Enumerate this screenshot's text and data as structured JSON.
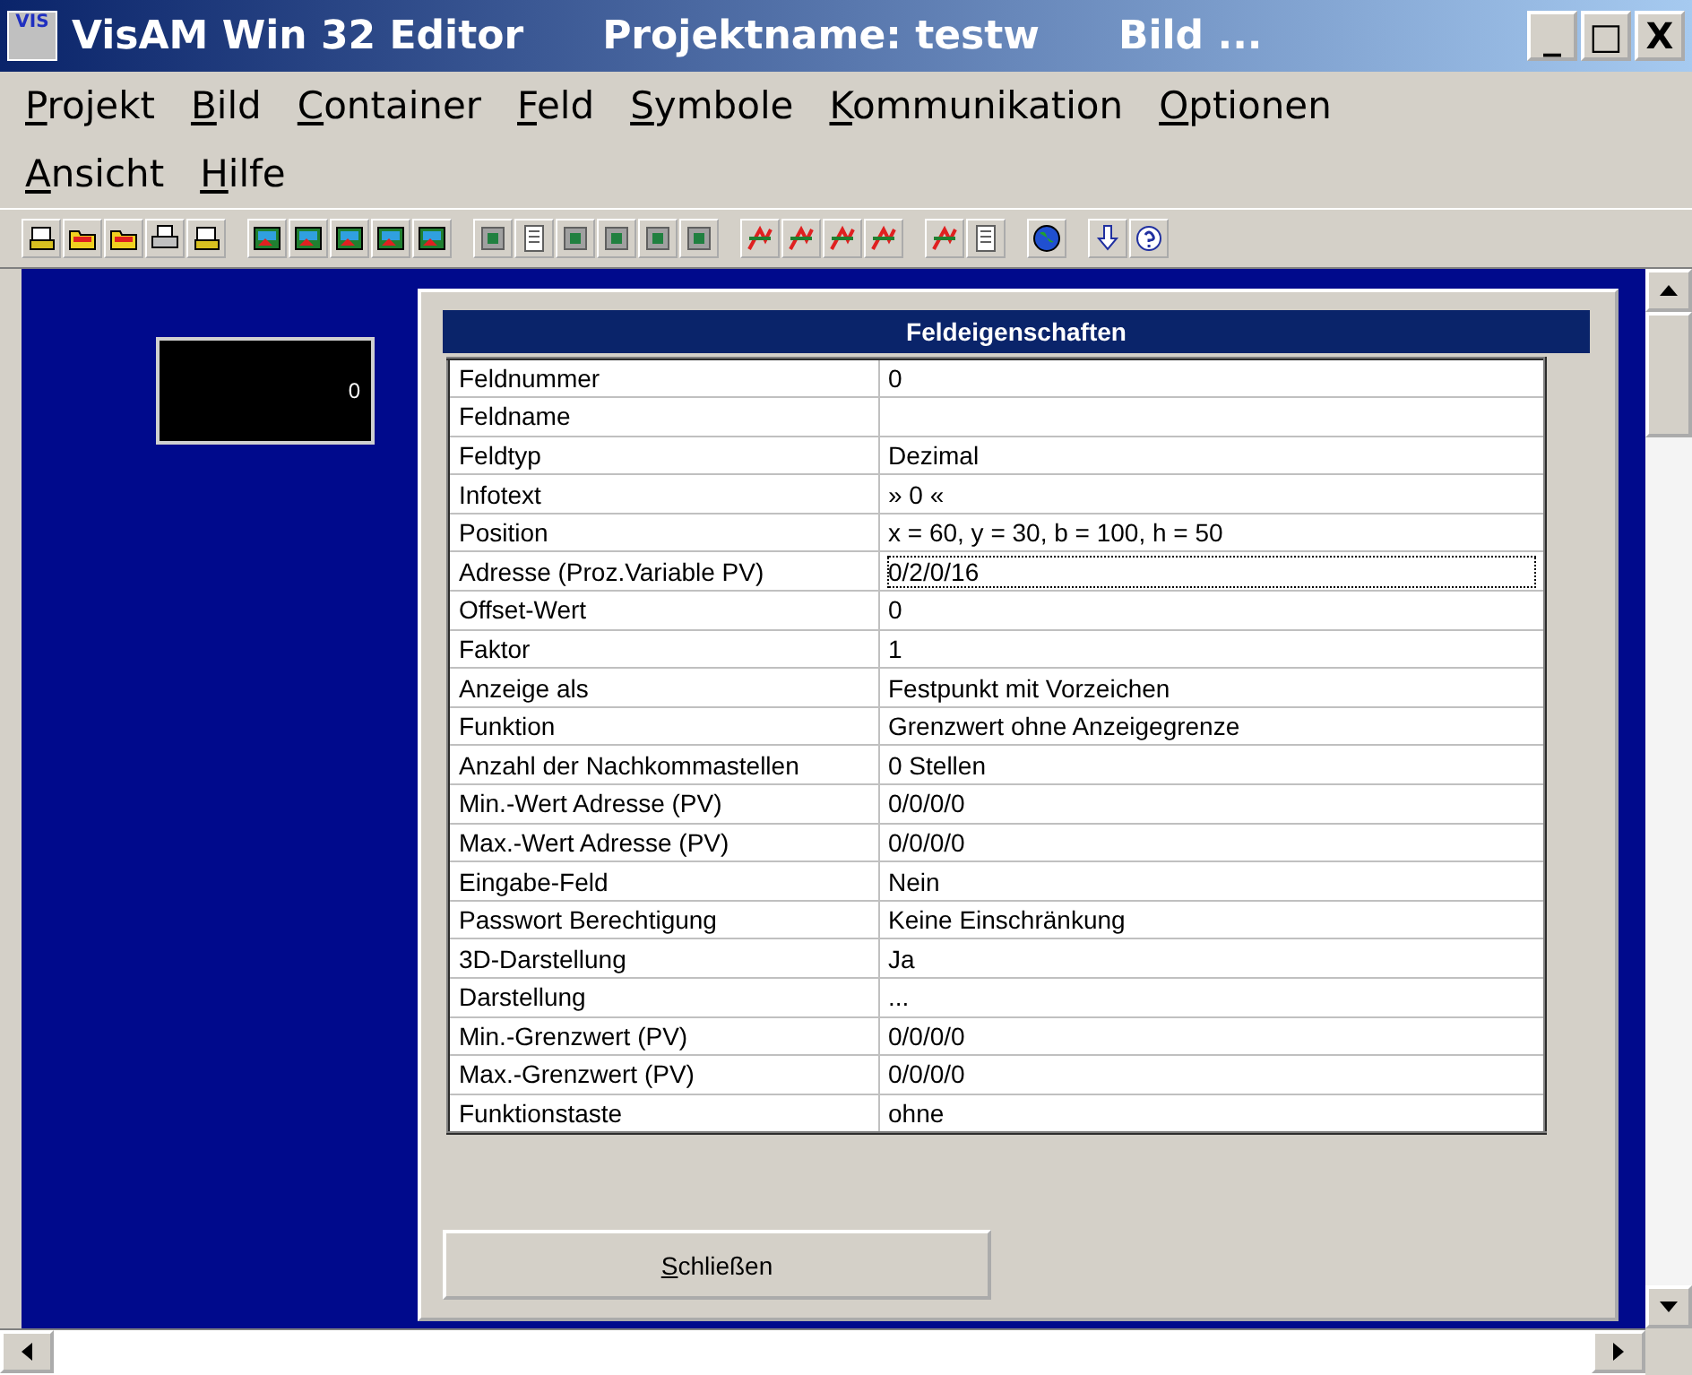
{
  "window": {
    "app_icon_text": "VIS",
    "title_parts": [
      "VisAM Win 32 Editor",
      "Projektname: testw",
      "Bild ..."
    ],
    "controls": [
      "_",
      "□",
      "X"
    ]
  },
  "menu": [
    {
      "label": "Projekt",
      "mnemonic": true
    },
    {
      "label": "Bild",
      "mnemonic": true
    },
    {
      "label": "Container",
      "mnemonic": true
    },
    {
      "label": "Feld",
      "mnemonic": true
    },
    {
      "label": "Symbole",
      "mnemonic": true
    },
    {
      "label": "Kommunikation",
      "mnemonic": true
    },
    {
      "label": "Optionen",
      "mnemonic": true
    },
    {
      "label": "Ansicht",
      "mnemonic": true
    },
    {
      "label": "Hilfe",
      "mnemonic": true
    }
  ],
  "canvas": {
    "field_value": "0"
  },
  "dialog": {
    "title": "Feldeigenschaften",
    "rows": [
      {
        "name": "Feldnummer",
        "value": "0",
        "focused": false
      },
      {
        "name": "Feldname",
        "focused": false
      },
      {
        "name": "Feldtyp",
        "value": "Dezimal",
        "focused": false
      },
      {
        "name": "Infotext",
        "value": "» 0 «",
        "focused": false
      },
      {
        "name": "Position",
        "value": "x = 60, y = 30, b = 100, h = 50",
        "focused": false
      },
      {
        "name": "Adresse (Proz.Variable PV)",
        "value": "0/2/0/16",
        "focused": true
      },
      {
        "name": "Offset-Wert",
        "value": "0",
        "focused": false
      },
      {
        "name": "Faktor",
        "value": "1",
        "focused": false
      },
      {
        "name": "Anzeige als",
        "value": "Festpunkt mit Vorzeichen",
        "focused": false
      },
      {
        "name": "Funktion",
        "value": "Grenzwert ohne Anzeigegrenze",
        "focused": false
      },
      {
        "name": "Anzahl der Nachkommastellen",
        "value": "0 Stellen",
        "focused": false
      },
      {
        "name": "Min.-Wert Adresse (PV)",
        "value": "0/0/0/0",
        "focused": false
      },
      {
        "name": "Max.-Wert Adresse (PV)",
        "value": "0/0/0/0",
        "focused": false
      },
      {
        "name": "Eingabe-Feld",
        "value": "Nein",
        "focused": false
      },
      {
        "name": "Passwort Berechtigung",
        "value": "Keine Einschränkung",
        "focused": false
      },
      {
        "name": "3D-Darstellung",
        "value": "Ja",
        "focused": false
      },
      {
        "name": "Darstellung",
        "value": "...",
        "focused": false
      },
      {
        "name": "Min.-Grenzwert (PV)",
        "value": "0/0/0/0",
        "focused": false
      },
      {
        "name": "Max.-Grenzwert (PV)",
        "value": "0/0/0/0",
        "focused": false
      },
      {
        "name": "Funktionstaste",
        "value": "ohne",
        "focused": false
      }
    ],
    "close_button": {
      "label": "Schließen",
      "mnemonic": true
    }
  }
}
